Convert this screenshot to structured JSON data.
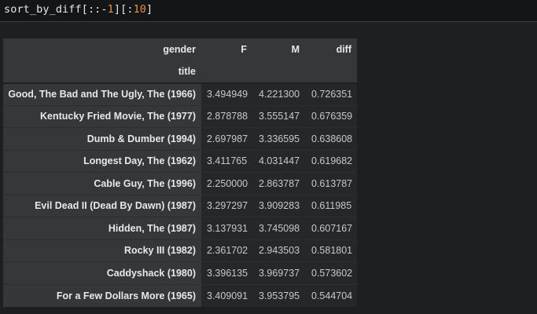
{
  "code": {
    "prefix": "sort_by_diff[::-",
    "num1": "1",
    "middle": "][:",
    "num2": "10",
    "suffix": "]"
  },
  "table": {
    "columns_name": "gender",
    "index_name": "title",
    "columns": [
      "F",
      "M",
      "diff"
    ],
    "rows": [
      {
        "title": "Good, The Bad and The Ugly, The (1966)",
        "F": "3.494949",
        "M": "4.221300",
        "diff": "0.726351"
      },
      {
        "title": "Kentucky Fried Movie, The (1977)",
        "F": "2.878788",
        "M": "3.555147",
        "diff": "0.676359"
      },
      {
        "title": "Dumb & Dumber (1994)",
        "F": "2.697987",
        "M": "3.336595",
        "diff": "0.638608"
      },
      {
        "title": "Longest Day, The (1962)",
        "F": "3.411765",
        "M": "4.031447",
        "diff": "0.619682"
      },
      {
        "title": "Cable Guy, The (1996)",
        "F": "2.250000",
        "M": "2.863787",
        "diff": "0.613787"
      },
      {
        "title": "Evil Dead II (Dead By Dawn) (1987)",
        "F": "3.297297",
        "M": "3.909283",
        "diff": "0.611985"
      },
      {
        "title": "Hidden, The (1987)",
        "F": "3.137931",
        "M": "3.745098",
        "diff": "0.607167"
      },
      {
        "title": "Rocky III (1982)",
        "F": "2.361702",
        "M": "2.943503",
        "diff": "0.581801"
      },
      {
        "title": "Caddyshack (1980)",
        "F": "3.396135",
        "M": "3.969737",
        "diff": "0.573602"
      },
      {
        "title": "For a Few Dollars More (1965)",
        "F": "3.409091",
        "M": "3.953795",
        "diff": "0.544704"
      }
    ]
  },
  "colors": {
    "background": "#1e1f22",
    "code_background": "#141517",
    "number_literal": "#f08d49",
    "header_background": "#363739",
    "cell_background": "#262729"
  }
}
